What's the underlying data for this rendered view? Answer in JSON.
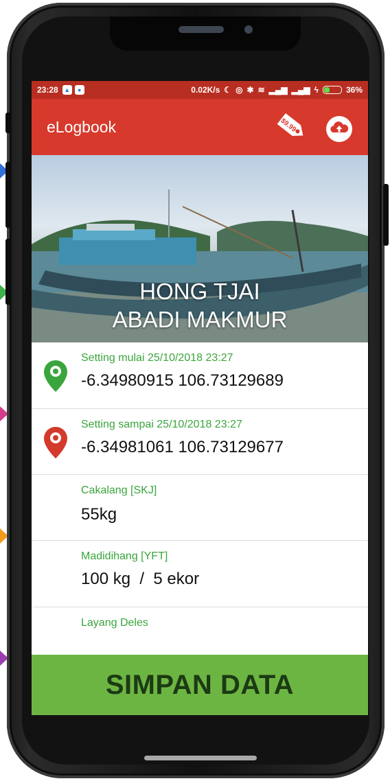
{
  "status_bar": {
    "time": "23:28",
    "network_speed": "0.02K/s",
    "battery_percent": "36%"
  },
  "app_bar": {
    "title": "eLogbook",
    "price_tag_text": "$9.99",
    "icons": [
      "price-tag-icon",
      "cloud-upload-icon"
    ]
  },
  "hero": {
    "vessel_name_line1": "HONG TJAI",
    "vessel_name_line2": "ABADI MAKMUR"
  },
  "entries": [
    {
      "label": "Setting mulai 25/10/2018 23:27",
      "value": "-6.34980915 106.73129689",
      "icon": "green-location-pin-icon"
    },
    {
      "label": "Setting sampai 25/10/2018 23:27",
      "value": "-6.34981061 106.73129677",
      "icon": "red-location-pin-icon"
    },
    {
      "label": "Cakalang [SKJ]",
      "value": "55kg"
    },
    {
      "label": "Madidihang [YFT]",
      "value": "100 kg  /  5 ekor"
    },
    {
      "label": "Layang Deles",
      "value": ""
    }
  ],
  "save_button": {
    "label": "SIMPAN DATA"
  },
  "colors": {
    "status_bar": "#b92e22",
    "app_bar": "#d7392c",
    "label_green": "#3aa53c",
    "save_button": "#6db543"
  }
}
